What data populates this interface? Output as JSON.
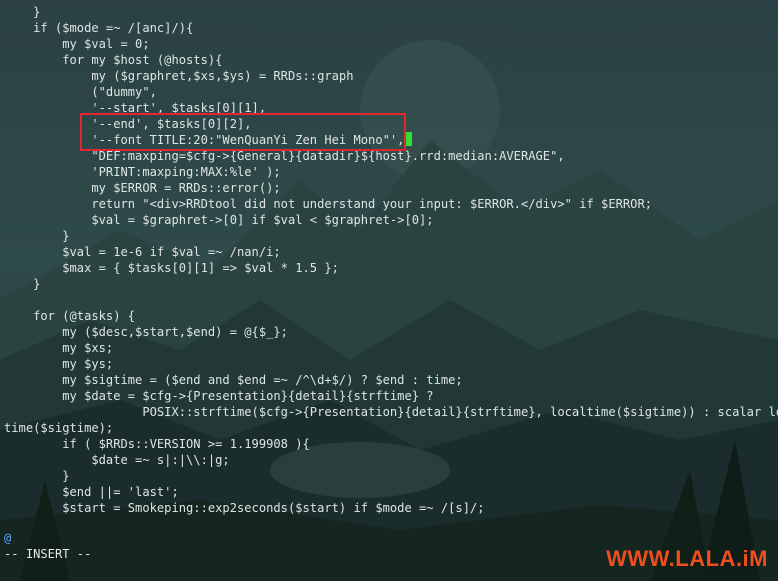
{
  "editor": {
    "lines": [
      "    }",
      "    if ($mode =~ /[anc]/){",
      "        my $val = 0;",
      "        for my $host (@hosts){",
      "            my ($graphret,$xs,$ys) = RRDs::graph",
      "            (\"dummy\",",
      "            '--start', $tasks[0][1],",
      "            '--end', $tasks[0][2],",
      "            '--font TITLE:20:\"WenQuanYi Zen Hei Mono\"',",
      "            \"DEF:maxping=$cfg->{General}{datadir}${host}.rrd:median:AVERAGE\",",
      "            'PRINT:maxping:MAX:%le' );",
      "            my $ERROR = RRDs::error();",
      "            return \"<div>RRDtool did not understand your input: $ERROR.</div>\" if $ERROR;",
      "            $val = $graphret->[0] if $val < $graphret->[0];",
      "        }",
      "        $val = 1e-6 if $val =~ /nan/i;",
      "        $max = { $tasks[0][1] => $val * 1.5 };",
      "    }",
      "",
      "    for (@tasks) {",
      "        my ($desc,$start,$end) = @{$_};",
      "        my $xs;",
      "        my $ys;",
      "        my $sigtime = ($end and $end =~ /^\\d+$/) ? $end : time;",
      "        my $date = $cfg->{Presentation}{detail}{strftime} ?",
      "                   POSIX::strftime($cfg->{Presentation}{detail}{strftime}, localtime($sigtime)) : scalar local",
      "time($sigtime);",
      "        if ( $RRDs::VERSION >= 1.199908 ){",
      "            $date =~ s|:|\\\\:|g;",
      "        }",
      "        $end ||= 'last';",
      "        $start = Smokeping::exp2seconds($start) if $mode =~ /[s]/;"
    ],
    "cursor_after_line": 8,
    "tilde_line": "@",
    "mode_line": "-- INSERT --"
  },
  "watermark": "WWW.LALA.iM",
  "colors": {
    "accent_highlight": "#e0262e",
    "cursor": "#2ee03a",
    "watermark": "#f04e1f",
    "background": "#1d3438"
  }
}
